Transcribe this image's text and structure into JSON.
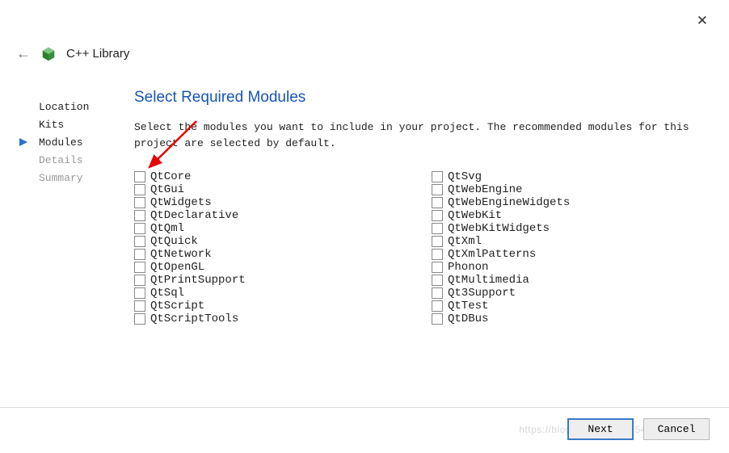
{
  "header": {
    "title": "C++ Library"
  },
  "sidebar": {
    "items": [
      {
        "label": "Location",
        "state": "done"
      },
      {
        "label": "Kits",
        "state": "done"
      },
      {
        "label": "Modules",
        "state": "active"
      },
      {
        "label": "Details",
        "state": "disabled"
      },
      {
        "label": "Summary",
        "state": "disabled"
      }
    ]
  },
  "content": {
    "title": "Select Required Modules",
    "description": "Select the modules you want to include in your project. The recommended modules for this project are selected by default."
  },
  "modules": {
    "col1": [
      "QtCore",
      "QtGui",
      "QtWidgets",
      "QtDeclarative",
      "QtQml",
      "QtQuick",
      "QtNetwork",
      "QtOpenGL",
      "QtPrintSupport",
      "QtSql",
      "QtScript",
      "QtScriptTools"
    ],
    "col2": [
      "QtSvg",
      "QtWebEngine",
      "QtWebEngineWidgets",
      "QtWebKit",
      "QtWebKitWidgets",
      "QtXml",
      "QtXmlPatterns",
      "Phonon",
      "QtMultimedia",
      "Qt3Support",
      "QtTest",
      "QtDBus"
    ]
  },
  "footer": {
    "next": "Next",
    "cancel": "Cancel"
  },
  "watermark": "https://blog.csdn.net/qq_54061187"
}
